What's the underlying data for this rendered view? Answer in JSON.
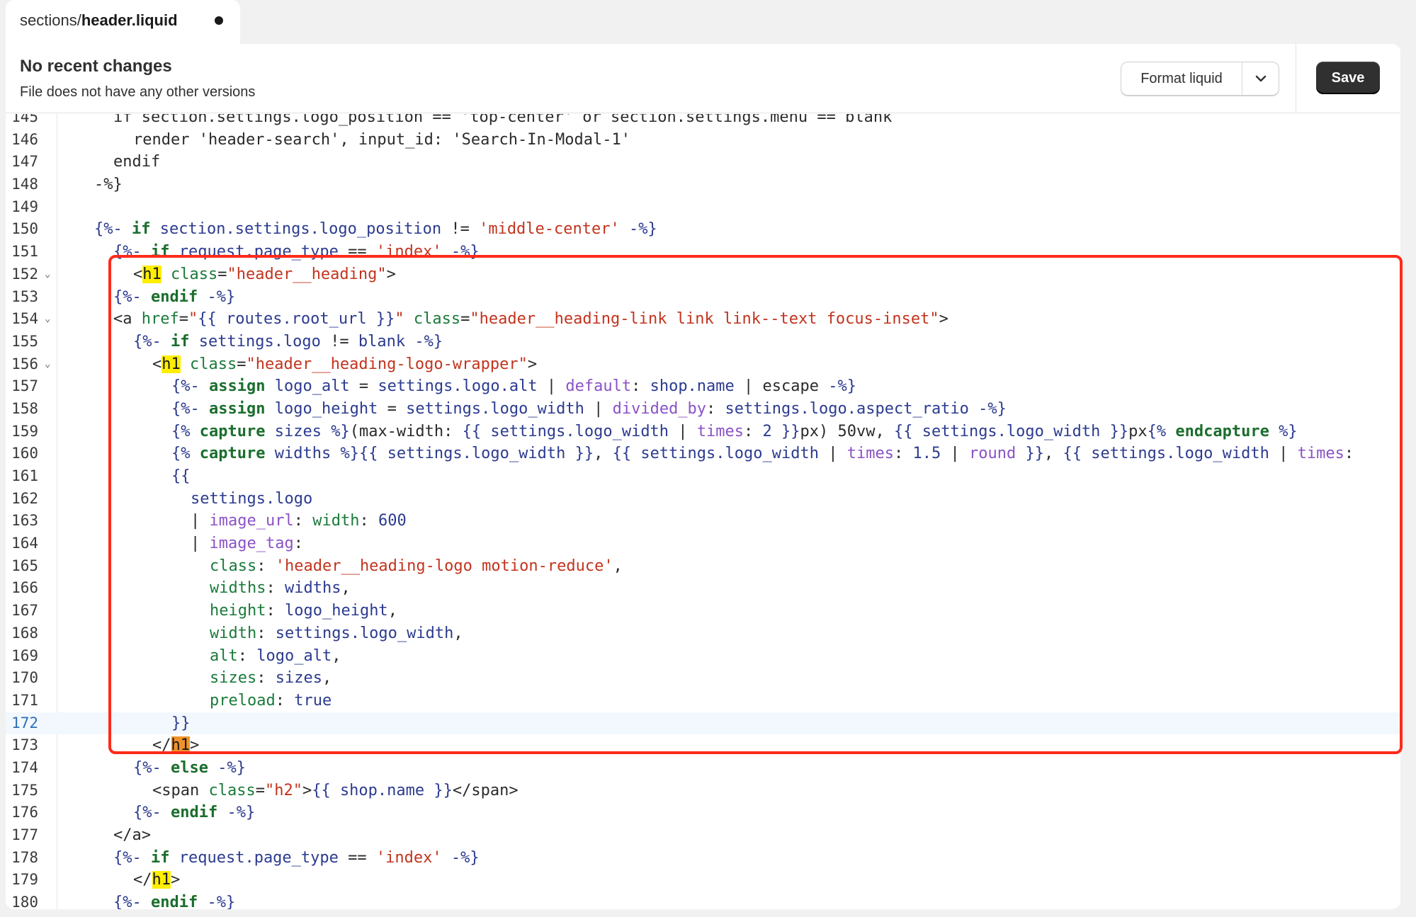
{
  "tab": {
    "path": "sections/",
    "file": "header.liquid"
  },
  "header": {
    "title": "No recent changes",
    "subtitle": "File does not have any other versions",
    "format_label": "Format liquid",
    "save_label": "Save"
  },
  "colors": {
    "keyword": "#1b6e2d",
    "variable": "#2c3b8f",
    "string": "#c2341e",
    "filter": "#8a52c6",
    "highlight": "#ffee00",
    "box": "#ff2a1a"
  },
  "code": {
    "l145": "if section.settings.logo_position == 'top-center' or section.settings.menu == blank",
    "l146": "render 'header-search', input_id: 'Search-In-Modal-1'",
    "l147": "endif",
    "l148": "-%}",
    "l150": "{%- if section.settings.logo_position != 'middle-center' -%}",
    "l151": "{%- if request.page_type == 'index' -%}",
    "l152": "<h1 class=\"header__heading\">",
    "l153": "{%- endif -%}",
    "l154": "<a href=\"{{ routes.root_url }}\" class=\"header__heading-link link link--text focus-inset\">",
    "l155": "{%- if settings.logo != blank -%}",
    "l156": "<h1 class=\"header__heading-logo-wrapper\">",
    "l157": "{%- assign logo_alt = settings.logo.alt | default: shop.name | escape -%}",
    "l158": "{%- assign logo_height = settings.logo_width | divided_by: settings.logo.aspect_ratio -%}",
    "l159": "{% capture sizes %}(max-width: {{ settings.logo_width | times: 2 }}px) 50vw, {{ settings.logo_width }}px{% endcapture %}",
    "l160": "{% capture widths %}{{ settings.logo_width }}, {{ settings.logo_width | times: 1.5 | round }}, {{ settings.logo_width | times:",
    "l161": "{{",
    "l162": "settings.logo",
    "l163": "| image_url: width: 600",
    "l164": "| image_tag:",
    "l165": "class: 'header__heading-logo motion-reduce',",
    "l166": "widths: widths,",
    "l167": "height: logo_height,",
    "l168": "width: settings.logo_width,",
    "l169": "alt: logo_alt,",
    "l170": "sizes: sizes,",
    "l171": "preload: true",
    "l172": "}}",
    "l173": "</h1>",
    "l174": "{%- else -%}",
    "l175": "<span class=\"h2\">{{ shop.name }}</span>",
    "l176": "{%- endif -%}",
    "l177": "</a>",
    "l178": "{%- if request.page_type == 'index' -%}",
    "l179": "</h1>",
    "l180": "{%- endif -%}"
  }
}
